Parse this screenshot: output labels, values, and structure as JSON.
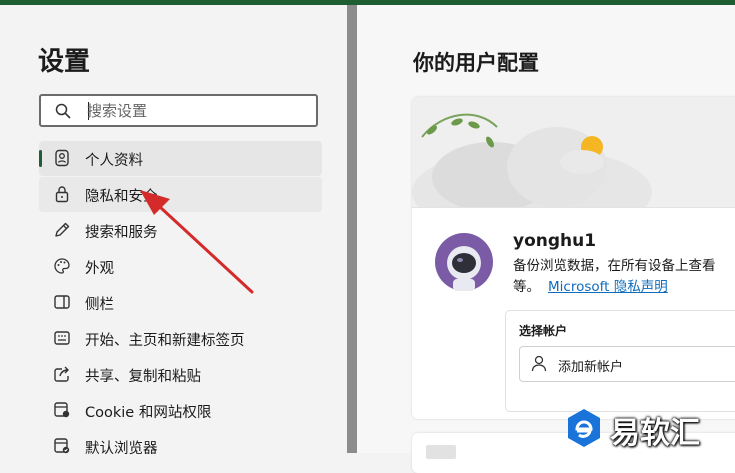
{
  "sidebar": {
    "title": "设置",
    "search": {
      "placeholder": "搜索设置",
      "value": ""
    },
    "items": [
      {
        "label": "个人资料",
        "icon": "profile-icon",
        "state": "active"
      },
      {
        "label": "隐私和安全",
        "icon": "lock-icon",
        "state": "hover"
      },
      {
        "label": "搜索和服务",
        "icon": "pencil-icon"
      },
      {
        "label": "外观",
        "icon": "palette-icon"
      },
      {
        "label": "侧栏",
        "icon": "sidebar-panel-icon"
      },
      {
        "label": "开始、主页和新建标签页",
        "icon": "start-home-icon"
      },
      {
        "label": "共享、复制和粘贴",
        "icon": "share-icon"
      },
      {
        "label": "Cookie 和网站权限",
        "icon": "site-permissions-icon"
      },
      {
        "label": "默认浏览器",
        "icon": "default-browser-icon"
      }
    ]
  },
  "main": {
    "title": "你的用户配置",
    "profile": {
      "username": "yonghu1",
      "description": "备份浏览数据，在所有设备上查看",
      "description_cont": "等。",
      "privacy_link": "Microsoft 隐私声明"
    },
    "account": {
      "label": "选择帐户",
      "add_button": "添加新帐户"
    }
  },
  "watermark": {
    "text": "易软汇"
  },
  "colors": {
    "accent": "#1f5e32",
    "link": "#0f6cbd",
    "arrow": "#d42a2a"
  }
}
